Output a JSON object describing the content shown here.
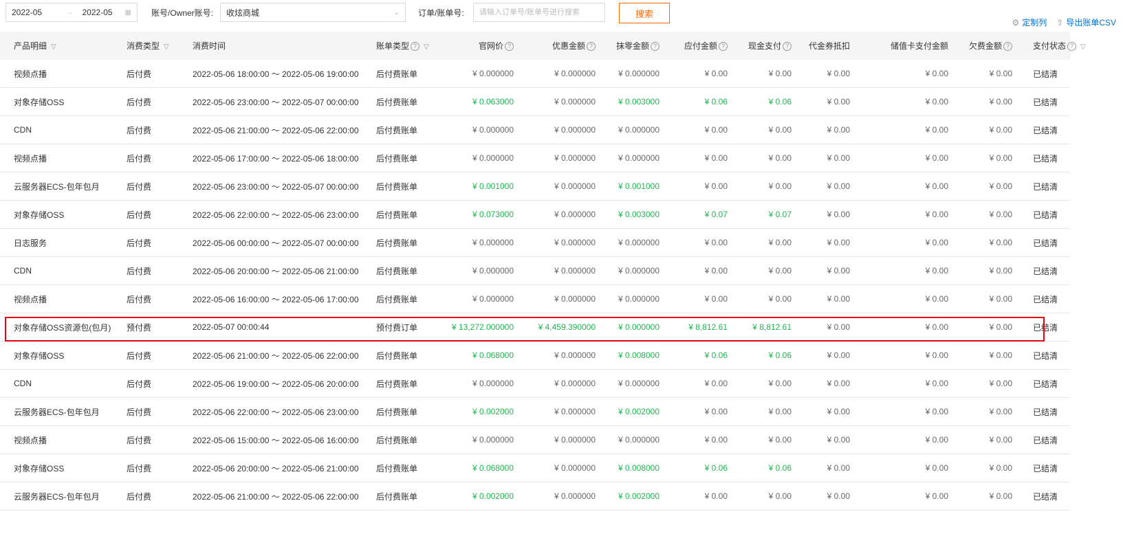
{
  "filters": {
    "date_start": "2022-05",
    "date_end": "2022-05",
    "account_label": "账号/Owner账号:",
    "account_value": "收炫商城",
    "order_label": "订单/账单号:",
    "order_placeholder": "请输入订单号/账单号进行搜索",
    "search_button": "搜索"
  },
  "links": {
    "customize": "定制列",
    "export": "导出账单CSV"
  },
  "columns": [
    "产品明细",
    "消费类型",
    "消费时间",
    "账单类型",
    "官网价",
    "优惠金额",
    "抹零金额",
    "应付金额",
    "现金支付",
    "代金券抵扣",
    "储值卡支付金额",
    "欠费金额",
    "支付状态"
  ],
  "rows": [
    {
      "product": "视频点播",
      "type": "后付费",
      "time": "2022-05-06 18:00:00 ～ 2022-05-06 19:00:00",
      "bill": "后付费账单",
      "list": "¥ 0.000000",
      "discount": "¥ 0.000000",
      "rounding": "¥ 0.000000",
      "payable": "¥ 0.00",
      "cash": "¥ 0.00",
      "voucher": "¥ 0.00",
      "card": "¥ 0.00",
      "owed": "¥ 0.00",
      "status": "已结清",
      "g": false
    },
    {
      "product": "对象存储OSS",
      "type": "后付费",
      "time": "2022-05-06 23:00:00 ～ 2022-05-07 00:00:00",
      "bill": "后付费账单",
      "list": "¥ 0.063000",
      "discount": "¥ 0.000000",
      "rounding": "¥ 0.003000",
      "payable": "¥ 0.06",
      "cash": "¥ 0.06",
      "voucher": "¥ 0.00",
      "card": "¥ 0.00",
      "owed": "¥ 0.00",
      "status": "已结清",
      "g": true
    },
    {
      "product": "CDN",
      "type": "后付费",
      "time": "2022-05-06 21:00:00 ～ 2022-05-06 22:00:00",
      "bill": "后付费账单",
      "list": "¥ 0.000000",
      "discount": "¥ 0.000000",
      "rounding": "¥ 0.000000",
      "payable": "¥ 0.00",
      "cash": "¥ 0.00",
      "voucher": "¥ 0.00",
      "card": "¥ 0.00",
      "owed": "¥ 0.00",
      "status": "已结清",
      "g": false
    },
    {
      "product": "视频点播",
      "type": "后付费",
      "time": "2022-05-06 17:00:00 ～ 2022-05-06 18:00:00",
      "bill": "后付费账单",
      "list": "¥ 0.000000",
      "discount": "¥ 0.000000",
      "rounding": "¥ 0.000000",
      "payable": "¥ 0.00",
      "cash": "¥ 0.00",
      "voucher": "¥ 0.00",
      "card": "¥ 0.00",
      "owed": "¥ 0.00",
      "status": "已结清",
      "g": false
    },
    {
      "product": "云服务器ECS-包年包月",
      "type": "后付费",
      "time": "2022-05-06 23:00:00 ～ 2022-05-07 00:00:00",
      "bill": "后付费账单",
      "list": "¥ 0.001000",
      "discount": "¥ 0.000000",
      "rounding": "¥ 0.001000",
      "payable": "¥ 0.00",
      "cash": "¥ 0.00",
      "voucher": "¥ 0.00",
      "card": "¥ 0.00",
      "owed": "¥ 0.00",
      "status": "已结清",
      "g": true,
      "gpart": true
    },
    {
      "product": "对象存储OSS",
      "type": "后付费",
      "time": "2022-05-06 22:00:00 ～ 2022-05-06 23:00:00",
      "bill": "后付费账单",
      "list": "¥ 0.073000",
      "discount": "¥ 0.000000",
      "rounding": "¥ 0.003000",
      "payable": "¥ 0.07",
      "cash": "¥ 0.07",
      "voucher": "¥ 0.00",
      "card": "¥ 0.00",
      "owed": "¥ 0.00",
      "status": "已结清",
      "g": true
    },
    {
      "product": "日志服务",
      "type": "后付费",
      "time": "2022-05-06 00:00:00 ～ 2022-05-07 00:00:00",
      "bill": "后付费账单",
      "list": "¥ 0.000000",
      "discount": "¥ 0.000000",
      "rounding": "¥ 0.000000",
      "payable": "¥ 0.00",
      "cash": "¥ 0.00",
      "voucher": "¥ 0.00",
      "card": "¥ 0.00",
      "owed": "¥ 0.00",
      "status": "已结清",
      "g": false
    },
    {
      "product": "CDN",
      "type": "后付费",
      "time": "2022-05-06 20:00:00 ～ 2022-05-06 21:00:00",
      "bill": "后付费账单",
      "list": "¥ 0.000000",
      "discount": "¥ 0.000000",
      "rounding": "¥ 0.000000",
      "payable": "¥ 0.00",
      "cash": "¥ 0.00",
      "voucher": "¥ 0.00",
      "card": "¥ 0.00",
      "owed": "¥ 0.00",
      "status": "已结清",
      "g": false
    },
    {
      "product": "视频点播",
      "type": "后付费",
      "time": "2022-05-06 16:00:00 ～ 2022-05-06 17:00:00",
      "bill": "后付费账单",
      "list": "¥ 0.000000",
      "discount": "¥ 0.000000",
      "rounding": "¥ 0.000000",
      "payable": "¥ 0.00",
      "cash": "¥ 0.00",
      "voucher": "¥ 0.00",
      "card": "¥ 0.00",
      "owed": "¥ 0.00",
      "status": "已结清",
      "g": false
    },
    {
      "product": "对象存储OSS资源包(包月)",
      "type": "预付费",
      "time": "2022-05-07 00:00:44",
      "bill": "预付费订单",
      "list": "¥ 13,272.000000",
      "discount": "¥ 4,459.390000",
      "rounding": "¥ 0.000000",
      "payable": "¥ 8,812.61",
      "cash": "¥ 8,812.61",
      "voucher": "¥ 0.00",
      "card": "¥ 0.00",
      "owed": "¥ 0.00",
      "status": "已结清",
      "g": true,
      "highlight": true
    },
    {
      "product": "对象存储OSS",
      "type": "后付费",
      "time": "2022-05-06 21:00:00 ～ 2022-05-06 22:00:00",
      "bill": "后付费账单",
      "list": "¥ 0.068000",
      "discount": "¥ 0.000000",
      "rounding": "¥ 0.008000",
      "payable": "¥ 0.06",
      "cash": "¥ 0.06",
      "voucher": "¥ 0.00",
      "card": "¥ 0.00",
      "owed": "¥ 0.00",
      "status": "已结清",
      "g": true
    },
    {
      "product": "CDN",
      "type": "后付费",
      "time": "2022-05-06 19:00:00 ～ 2022-05-06 20:00:00",
      "bill": "后付费账单",
      "list": "¥ 0.000000",
      "discount": "¥ 0.000000",
      "rounding": "¥ 0.000000",
      "payable": "¥ 0.00",
      "cash": "¥ 0.00",
      "voucher": "¥ 0.00",
      "card": "¥ 0.00",
      "owed": "¥ 0.00",
      "status": "已结清",
      "g": false
    },
    {
      "product": "云服务器ECS-包年包月",
      "type": "后付费",
      "time": "2022-05-06 22:00:00 ～ 2022-05-06 23:00:00",
      "bill": "后付费账单",
      "list": "¥ 0.002000",
      "discount": "¥ 0.000000",
      "rounding": "¥ 0.002000",
      "payable": "¥ 0.00",
      "cash": "¥ 0.00",
      "voucher": "¥ 0.00",
      "card": "¥ 0.00",
      "owed": "¥ 0.00",
      "status": "已结清",
      "g": true,
      "gpart": true
    },
    {
      "product": "视频点播",
      "type": "后付费",
      "time": "2022-05-06 15:00:00 ～ 2022-05-06 16:00:00",
      "bill": "后付费账单",
      "list": "¥ 0.000000",
      "discount": "¥ 0.000000",
      "rounding": "¥ 0.000000",
      "payable": "¥ 0.00",
      "cash": "¥ 0.00",
      "voucher": "¥ 0.00",
      "card": "¥ 0.00",
      "owed": "¥ 0.00",
      "status": "已结清",
      "g": false
    },
    {
      "product": "对象存储OSS",
      "type": "后付费",
      "time": "2022-05-06 20:00:00 ～ 2022-05-06 21:00:00",
      "bill": "后付费账单",
      "list": "¥ 0.068000",
      "discount": "¥ 0.000000",
      "rounding": "¥ 0.008000",
      "payable": "¥ 0.06",
      "cash": "¥ 0.06",
      "voucher": "¥ 0.00",
      "card": "¥ 0.00",
      "owed": "¥ 0.00",
      "status": "已结清",
      "g": true
    },
    {
      "product": "云服务器ECS-包年包月",
      "type": "后付费",
      "time": "2022-05-06 21:00:00 ～ 2022-05-06 22:00:00",
      "bill": "后付费账单",
      "list": "¥ 0.002000",
      "discount": "¥ 0.000000",
      "rounding": "¥ 0.002000",
      "payable": "¥ 0.00",
      "cash": "¥ 0.00",
      "voucher": "¥ 0.00",
      "card": "¥ 0.00",
      "owed": "¥ 0.00",
      "status": "已结清",
      "g": true,
      "gpart": true
    }
  ],
  "colors": {
    "accent": "#ff6a00",
    "link": "#0070cc",
    "green": "#1fb54f",
    "highlight": "#e60012"
  }
}
